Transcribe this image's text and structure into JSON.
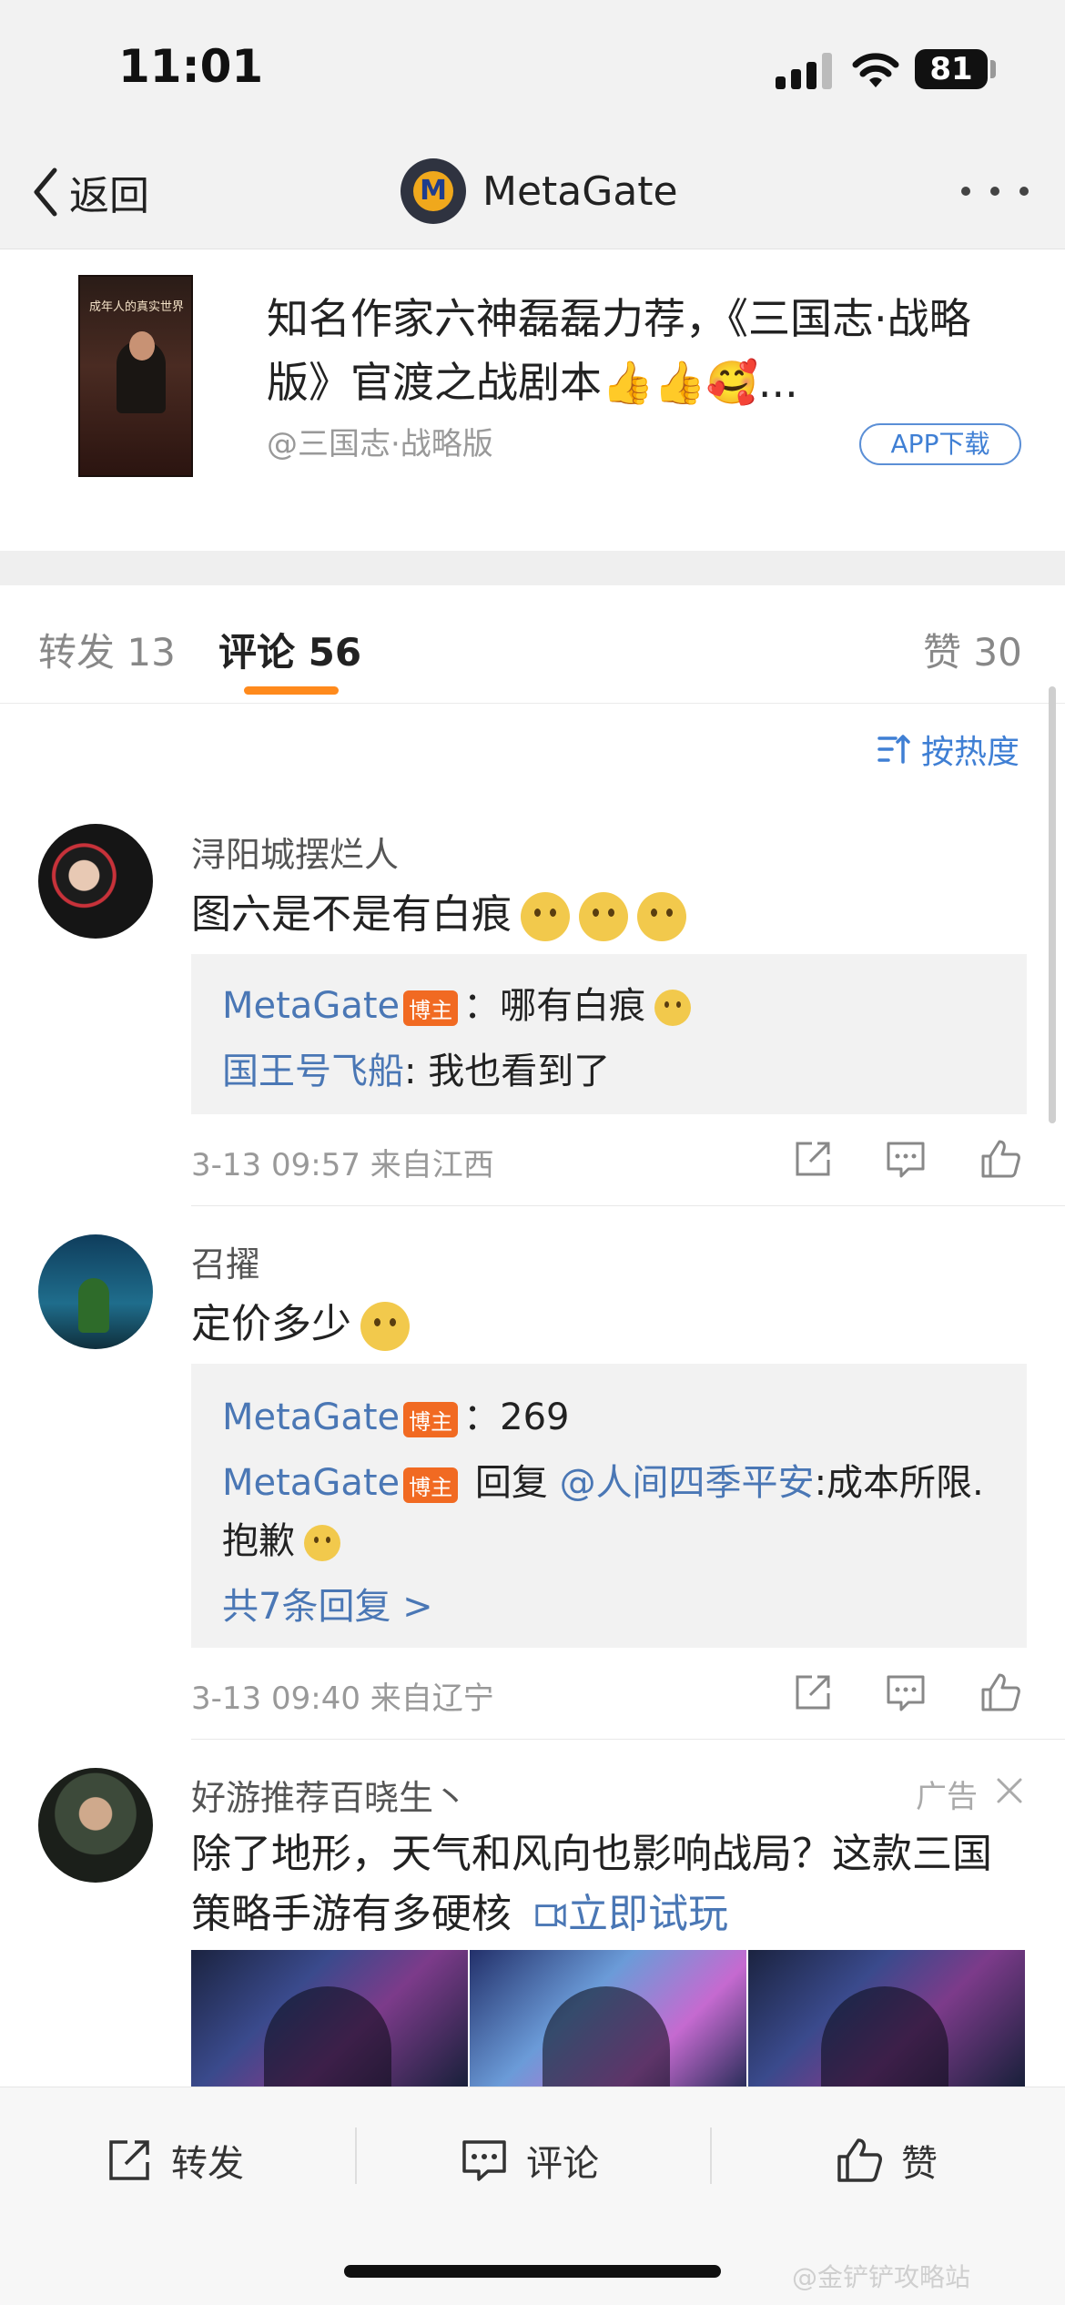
{
  "status_bar": {
    "time": "11:01",
    "battery": "81"
  },
  "nav": {
    "back_label": "返回",
    "title": "MetaGate"
  },
  "ad_card": {
    "thumb_title": "成年人的真实世界",
    "title": "知名作家六神磊磊力荐，《三国志·战略版》官渡之战剧本👍👍🥰...",
    "source": "@三国志·战略版",
    "download_label": "APP下载"
  },
  "tabs": {
    "forward": "转发 13",
    "comments": "评论 56",
    "likes": "赞 30"
  },
  "sort": {
    "label": "按热度"
  },
  "comments": [
    {
      "username": "浔阳城摆烂人",
      "text": "图六是不是有白痕",
      "replies": [
        {
          "user": "MetaGate",
          "badge": "博主",
          "text": "：哪有白痕"
        },
        {
          "user": "国王号飞船",
          "text": ": 我也看到了"
        }
      ],
      "meta": "3-13 09:57  来自江西"
    },
    {
      "username": "召擢",
      "text": "定价多少",
      "replies": [
        {
          "user": "MetaGate",
          "badge": "博主",
          "text": "：269"
        },
        {
          "user": "MetaGate",
          "badge": "博主",
          "pre": " 回复 ",
          "mention": "@人间四季平安",
          "text": ":成本所限."
        },
        {
          "text": "抱歉"
        }
      ],
      "more_replies": "共7条回复 >",
      "meta": "3-13 09:40  来自辽宁"
    }
  ],
  "ad_post": {
    "username": "好游推荐百晓生丶",
    "tag": "广告",
    "text_line1": "除了地形，天气和风向也影响战局？这款三国",
    "text_line2": "策略手游有多硬核",
    "try_label": "立即试玩"
  },
  "bottom_bar": {
    "forward": "转发",
    "comment": "评论",
    "like": "赞"
  },
  "watermark": "@金铲铲攻略站"
}
